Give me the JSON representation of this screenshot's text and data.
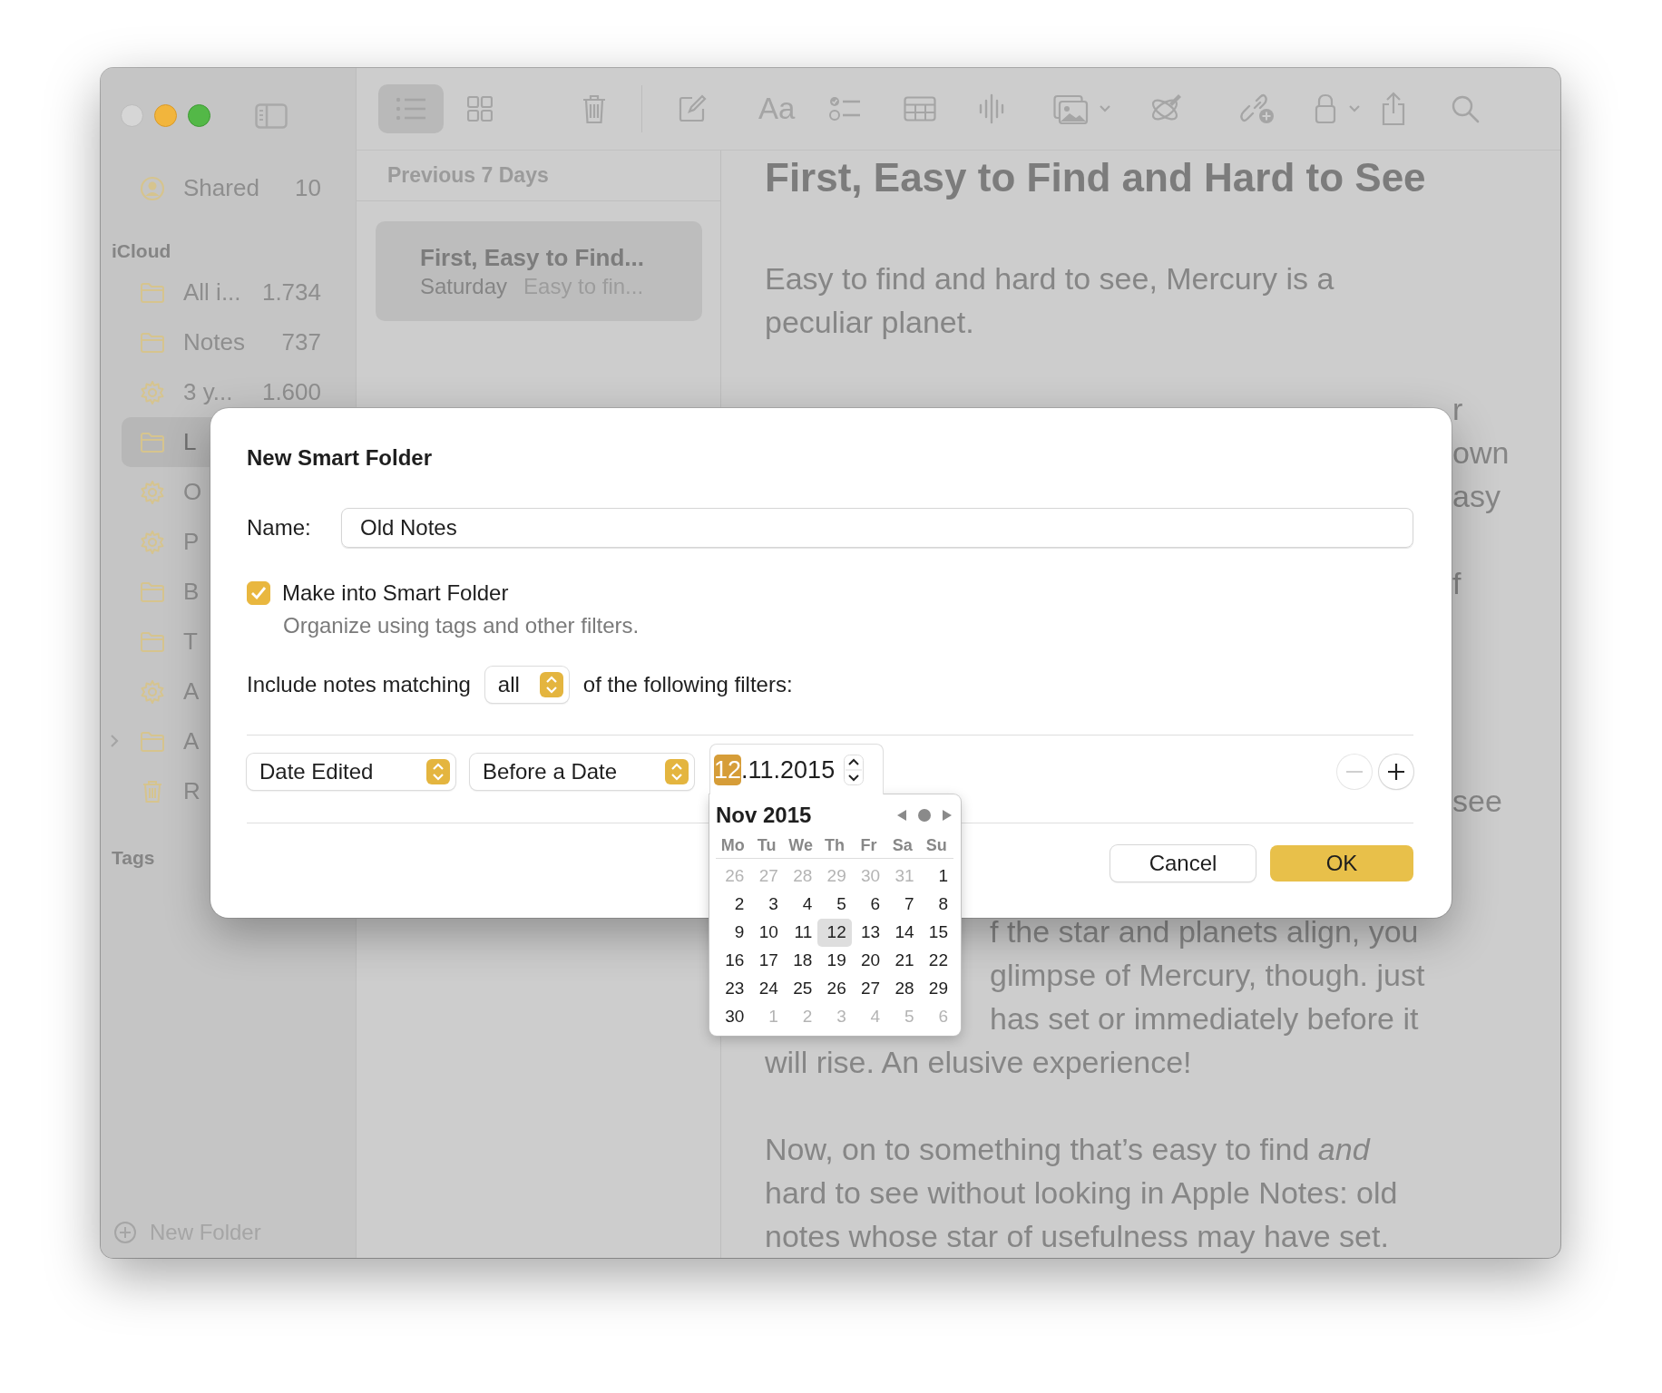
{
  "toolbar": {
    "view_buttons": [
      {
        "kind": "list",
        "selected": true
      },
      {
        "kind": "grid",
        "selected": false
      }
    ],
    "format_button": "Aa"
  },
  "sidebar": {
    "shared": {
      "label": "Shared",
      "count": "10"
    },
    "section": "iCloud",
    "items": [
      {
        "kind": "folder",
        "label": "All i...",
        "count": "1.734",
        "selected": false
      },
      {
        "kind": "folder",
        "label": "Notes",
        "count": "737",
        "selected": false
      },
      {
        "kind": "smart",
        "label": "3 y...",
        "count": "1.600",
        "selected": false
      },
      {
        "kind": "folder",
        "label": "L",
        "selected": true
      },
      {
        "kind": "smart",
        "label": "O",
        "selected": false
      },
      {
        "kind": "smart",
        "label": "P",
        "selected": false
      },
      {
        "kind": "folder",
        "label": "B",
        "selected": false
      },
      {
        "kind": "folder",
        "label": "T",
        "selected": false
      },
      {
        "kind": "smart",
        "label": "A",
        "selected": false
      },
      {
        "kind": "folder",
        "label": "A",
        "selected": false,
        "expanded": false
      },
      {
        "kind": "trash",
        "label": "R",
        "selected": false
      }
    ],
    "tags_heading": "Tags",
    "new_folder": "New Folder"
  },
  "note_list": {
    "header": "Previous 7 Days",
    "notes": [
      {
        "title": "First, Easy to Find...",
        "date": "Saturday",
        "preview": "Easy to fin...",
        "selected": true
      }
    ]
  },
  "note": {
    "title": "First, Easy to Find and Hard to See",
    "lines": [
      {
        "kind": "full",
        "text": "Easy to find and hard to see, Mercury is a"
      },
      {
        "kind": "full",
        "text": "peculiar planet."
      },
      {
        "kind": "covered"
      },
      {
        "kind": "tail",
        "text": "r"
      },
      {
        "kind": "tail",
        "text": "own"
      },
      {
        "kind": "tail",
        "text": "asy"
      },
      {
        "kind": "covered"
      },
      {
        "kind": "tail",
        "text": "f"
      },
      {
        "kind": "covered"
      },
      {
        "kind": "covered"
      },
      {
        "kind": "covered"
      },
      {
        "kind": "covered"
      },
      {
        "kind": "tail",
        "text": "see"
      },
      {
        "kind": "covered"
      },
      {
        "kind": "covered"
      },
      {
        "kind": "partial",
        "text": "f the star and planets align, you"
      },
      {
        "kind": "partial",
        "text": "glimpse of Mercury, though. just"
      },
      {
        "kind": "partial",
        "text": "has set or immediately before it"
      },
      {
        "kind": "full",
        "text": "will rise. An elusive experience!"
      },
      {
        "kind": "covered"
      },
      {
        "kind": "full",
        "text": "Now, on to something that’s easy to find *and*"
      },
      {
        "kind": "full",
        "text": "hard to see without looking in Apple Notes: old"
      },
      {
        "kind": "full",
        "text": "notes whose star of usefulness may have set."
      }
    ]
  },
  "dialog": {
    "title": "New Smart Folder",
    "name_label": "Name:",
    "name_value": "Old Notes",
    "smart_checkbox": {
      "label": "Make into Smart Folder",
      "checked": true,
      "description": "Organize using tags and other filters."
    },
    "match": {
      "prefix": "Include notes matching",
      "value": "all",
      "suffix": "of the following filters:"
    },
    "filters": [
      {
        "field": "Date Edited",
        "operator": "Before a Date",
        "date_segments": [
          {
            "text": "12",
            "selected": true
          },
          {
            "text": ".11.2015",
            "selected": false
          }
        ]
      }
    ],
    "filter_controls": [
      {
        "kind": "remove",
        "disabled": true
      },
      {
        "kind": "add",
        "disabled": false
      }
    ],
    "buttons": [
      {
        "label": "Cancel",
        "kind": "secondary"
      },
      {
        "label": "OK",
        "kind": "primary"
      }
    ]
  },
  "calendar": {
    "title": "Nov 2015",
    "weekdays": [
      "Mo",
      "Tu",
      "We",
      "Th",
      "Fr",
      "Sa",
      "Su"
    ],
    "days": [
      {
        "text": "26",
        "in_month": false,
        "selected": false
      },
      {
        "text": "27",
        "in_month": false,
        "selected": false
      },
      {
        "text": "28",
        "in_month": false,
        "selected": false
      },
      {
        "text": "29",
        "in_month": false,
        "selected": false
      },
      {
        "text": "30",
        "in_month": false,
        "selected": false
      },
      {
        "text": "31",
        "in_month": false,
        "selected": false
      },
      {
        "text": "1",
        "in_month": true,
        "selected": false
      },
      {
        "text": "2",
        "in_month": true,
        "selected": false
      },
      {
        "text": "3",
        "in_month": true,
        "selected": false
      },
      {
        "text": "4",
        "in_month": true,
        "selected": false
      },
      {
        "text": "5",
        "in_month": true,
        "selected": false
      },
      {
        "text": "6",
        "in_month": true,
        "selected": false
      },
      {
        "text": "7",
        "in_month": true,
        "selected": false
      },
      {
        "text": "8",
        "in_month": true,
        "selected": false
      },
      {
        "text": "9",
        "in_month": true,
        "selected": false
      },
      {
        "text": "10",
        "in_month": true,
        "selected": false
      },
      {
        "text": "11",
        "in_month": true,
        "selected": false
      },
      {
        "text": "12",
        "in_month": true,
        "selected": true
      },
      {
        "text": "13",
        "in_month": true,
        "selected": false
      },
      {
        "text": "14",
        "in_month": true,
        "selected": false
      },
      {
        "text": "15",
        "in_month": true,
        "selected": false
      },
      {
        "text": "16",
        "in_month": true,
        "selected": false
      },
      {
        "text": "17",
        "in_month": true,
        "selected": false
      },
      {
        "text": "18",
        "in_month": true,
        "selected": false
      },
      {
        "text": "19",
        "in_month": true,
        "selected": false
      },
      {
        "text": "20",
        "in_month": true,
        "selected": false
      },
      {
        "text": "21",
        "in_month": true,
        "selected": false
      },
      {
        "text": "22",
        "in_month": true,
        "selected": false
      },
      {
        "text": "23",
        "in_month": true,
        "selected": false
      },
      {
        "text": "24",
        "in_month": true,
        "selected": false
      },
      {
        "text": "25",
        "in_month": true,
        "selected": false
      },
      {
        "text": "26",
        "in_month": true,
        "selected": false
      },
      {
        "text": "27",
        "in_month": true,
        "selected": false
      },
      {
        "text": "28",
        "in_month": true,
        "selected": false
      },
      {
        "text": "29",
        "in_month": true,
        "selected": false
      },
      {
        "text": "30",
        "in_month": true,
        "selected": false
      },
      {
        "text": "1",
        "in_month": false,
        "selected": false
      },
      {
        "text": "2",
        "in_month": false,
        "selected": false
      },
      {
        "text": "3",
        "in_month": false,
        "selected": false
      },
      {
        "text": "4",
        "in_month": false,
        "selected": false
      },
      {
        "text": "5",
        "in_month": false,
        "selected": false
      },
      {
        "text": "6",
        "in_month": false,
        "selected": false
      }
    ]
  }
}
